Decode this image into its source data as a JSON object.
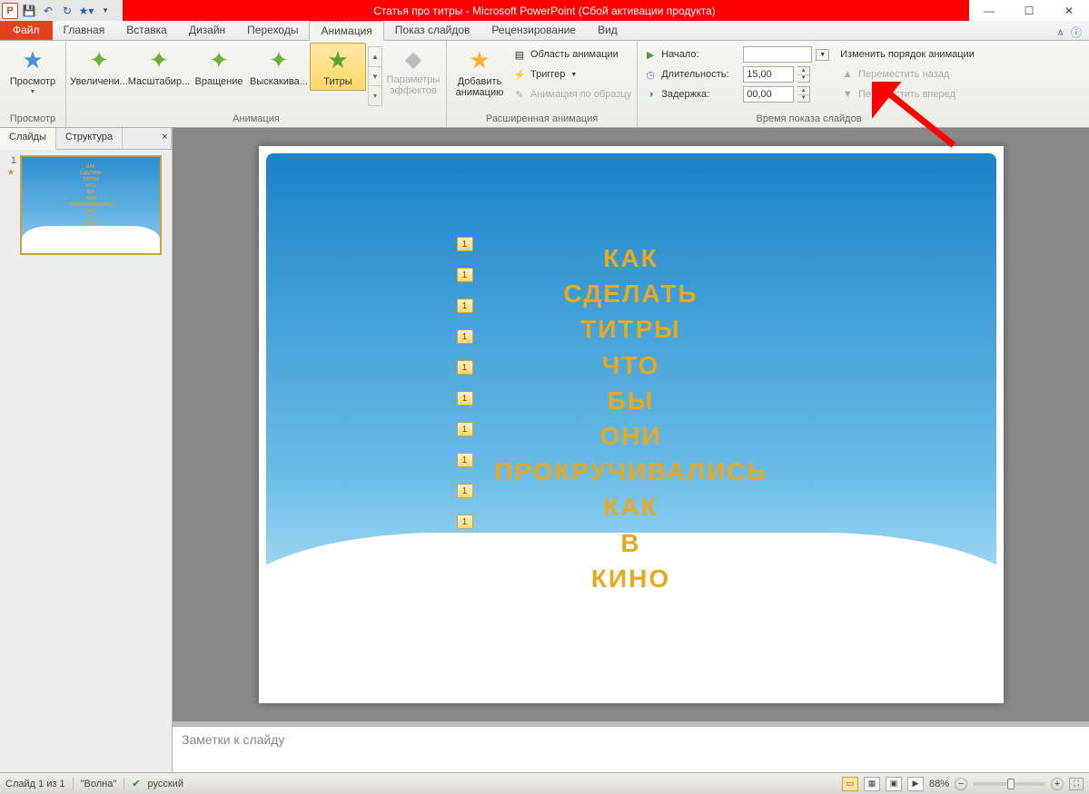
{
  "title": "Статья про титры  - Microsoft PowerPoint (Сбой активации продукта)",
  "filetab": "Файл",
  "tabs": [
    "Главная",
    "Вставка",
    "Дизайн",
    "Переходы",
    "Анимация",
    "Показ слайдов",
    "Рецензирование",
    "Вид"
  ],
  "active_tab_index": 4,
  "ribbon": {
    "preview": {
      "label": "Просмотр",
      "group": "Просмотр"
    },
    "anim_group_label": "Анимация",
    "effects": [
      "Увеличени...",
      "Масштабир...",
      "Вращение",
      "Выскакива...",
      "Титры"
    ],
    "selected_effect_index": 4,
    "effect_params": "Параметры эффектов",
    "adv_group_label": "Расширенная анимация",
    "add_anim": "Добавить анимацию",
    "anim_pane": "Область анимации",
    "trigger": "Триггер",
    "anim_painter": "Анимация по образцу",
    "timing_group_label": "Время показа слайдов",
    "start_label": "Начало:",
    "start_value": "",
    "duration_label": "Длительность:",
    "duration_value": "15,00",
    "delay_label": "Задержка:",
    "delay_value": "00,00",
    "reorder_label": "Изменить порядок анимации",
    "move_back": "Переместить назад",
    "move_fwd": "Переместить вперед"
  },
  "sidepane": {
    "tab_slides": "Слайды",
    "tab_outline": "Структура",
    "slide_num": "1"
  },
  "anim_tag": "1",
  "credits_lines": [
    "КАК",
    "СДЕЛАТЬ",
    "ТИТРЫ",
    "ЧТО",
    "БЫ",
    "ОНИ",
    "ПРОКРУЧИВАЛИСЬ",
    "КАК",
    "В",
    "КИНО"
  ],
  "notes_placeholder": "Заметки к слайду",
  "status": {
    "slide_info": "Слайд 1 из 1",
    "theme": "\"Волна\"",
    "lang": "русский",
    "zoom": "88%"
  }
}
